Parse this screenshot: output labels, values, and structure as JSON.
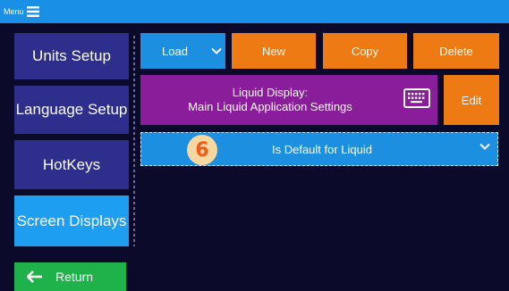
{
  "topbar": {
    "menu_label": "Menu",
    "menu_icon": "hamburger-icon",
    "bg_color": "#1a8fe6"
  },
  "sidebar": {
    "items": [
      {
        "label": "Units Setup",
        "state": "normal"
      },
      {
        "label": "Language Setup",
        "state": "normal"
      },
      {
        "label": "HotKeys",
        "state": "normal"
      },
      {
        "label": "Screen Displays",
        "state": "active"
      }
    ],
    "return_label": "Return",
    "return_icon": "arrow-left-icon"
  },
  "toolbar": {
    "load_label": "Load",
    "new_label": "New",
    "copy_label": "Copy",
    "delete_label": "Delete"
  },
  "liquid_display": {
    "title": "Liquid Display:",
    "subtitle": "Main Liquid Application Settings",
    "keyboard_icon": "keyboard-icon",
    "edit_label": "Edit"
  },
  "default_dropdown": {
    "label": "Is Default for Liquid",
    "icon": "chevron-down-icon"
  },
  "step_badge": {
    "number": "6"
  },
  "colors": {
    "background": "#0c0a2b",
    "sidebar_normal": "#2e2e8c",
    "sidebar_active": "#1d9ef0",
    "blue_button": "#1d8fe0",
    "orange_button": "#ee7a14",
    "purple_panel": "#8a1e9a",
    "return_green": "#1fb24b",
    "badge_text": "#f05a1a"
  }
}
